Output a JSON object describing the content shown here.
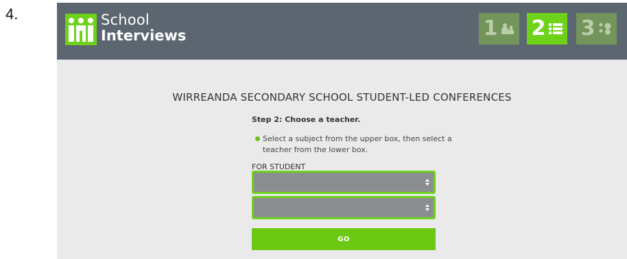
{
  "figure_label": "4.",
  "brand": {
    "line1": "School",
    "line2": "Interviews"
  },
  "steps": [
    {
      "number": "1",
      "icon": "people-icon",
      "active": false
    },
    {
      "number": "2",
      "icon": "list-icon",
      "active": true
    },
    {
      "number": "3",
      "icon": "schedule-icon",
      "active": false
    }
  ],
  "page_title": "WIRREANDA SECONDARY SCHOOL STUDENT-LED CONFERENCES",
  "step_heading": "Step 2: Choose a teacher.",
  "instruction": "Select a subject from the upper box, then select a teacher from the lower box.",
  "form": {
    "student_label": "FOR STUDENT",
    "subject_select_value": "",
    "teacher_select_value": "",
    "go_label": "GO"
  },
  "colors": {
    "header_bg": "#5b6670",
    "accent_green": "#6ed21a",
    "inactive_step": "#73955c",
    "page_bg": "#eaeaea",
    "select_bg": "#8b8e91"
  }
}
